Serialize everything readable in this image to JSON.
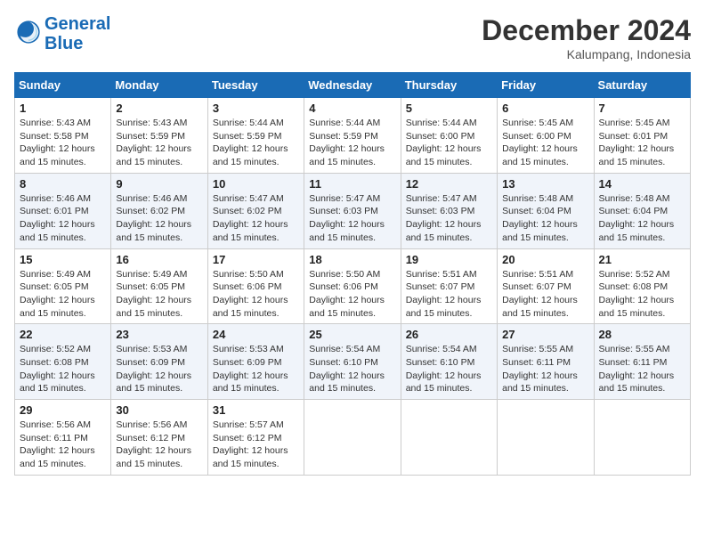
{
  "logo": {
    "line1": "General",
    "line2": "Blue"
  },
  "title": "December 2024",
  "location": "Kalumpang, Indonesia",
  "days_of_week": [
    "Sunday",
    "Monday",
    "Tuesday",
    "Wednesday",
    "Thursday",
    "Friday",
    "Saturday"
  ],
  "weeks": [
    [
      {
        "day": "1",
        "sunrise": "5:43 AM",
        "sunset": "5:58 PM",
        "daylight": "12 hours and 15 minutes."
      },
      {
        "day": "2",
        "sunrise": "5:43 AM",
        "sunset": "5:59 PM",
        "daylight": "12 hours and 15 minutes."
      },
      {
        "day": "3",
        "sunrise": "5:44 AM",
        "sunset": "5:59 PM",
        "daylight": "12 hours and 15 minutes."
      },
      {
        "day": "4",
        "sunrise": "5:44 AM",
        "sunset": "5:59 PM",
        "daylight": "12 hours and 15 minutes."
      },
      {
        "day": "5",
        "sunrise": "5:44 AM",
        "sunset": "6:00 PM",
        "daylight": "12 hours and 15 minutes."
      },
      {
        "day": "6",
        "sunrise": "5:45 AM",
        "sunset": "6:00 PM",
        "daylight": "12 hours and 15 minutes."
      },
      {
        "day": "7",
        "sunrise": "5:45 AM",
        "sunset": "6:01 PM",
        "daylight": "12 hours and 15 minutes."
      }
    ],
    [
      {
        "day": "8",
        "sunrise": "5:46 AM",
        "sunset": "6:01 PM",
        "daylight": "12 hours and 15 minutes."
      },
      {
        "day": "9",
        "sunrise": "5:46 AM",
        "sunset": "6:02 PM",
        "daylight": "12 hours and 15 minutes."
      },
      {
        "day": "10",
        "sunrise": "5:47 AM",
        "sunset": "6:02 PM",
        "daylight": "12 hours and 15 minutes."
      },
      {
        "day": "11",
        "sunrise": "5:47 AM",
        "sunset": "6:03 PM",
        "daylight": "12 hours and 15 minutes."
      },
      {
        "day": "12",
        "sunrise": "5:47 AM",
        "sunset": "6:03 PM",
        "daylight": "12 hours and 15 minutes."
      },
      {
        "day": "13",
        "sunrise": "5:48 AM",
        "sunset": "6:04 PM",
        "daylight": "12 hours and 15 minutes."
      },
      {
        "day": "14",
        "sunrise": "5:48 AM",
        "sunset": "6:04 PM",
        "daylight": "12 hours and 15 minutes."
      }
    ],
    [
      {
        "day": "15",
        "sunrise": "5:49 AM",
        "sunset": "6:05 PM",
        "daylight": "12 hours and 15 minutes."
      },
      {
        "day": "16",
        "sunrise": "5:49 AM",
        "sunset": "6:05 PM",
        "daylight": "12 hours and 15 minutes."
      },
      {
        "day": "17",
        "sunrise": "5:50 AM",
        "sunset": "6:06 PM",
        "daylight": "12 hours and 15 minutes."
      },
      {
        "day": "18",
        "sunrise": "5:50 AM",
        "sunset": "6:06 PM",
        "daylight": "12 hours and 15 minutes."
      },
      {
        "day": "19",
        "sunrise": "5:51 AM",
        "sunset": "6:07 PM",
        "daylight": "12 hours and 15 minutes."
      },
      {
        "day": "20",
        "sunrise": "5:51 AM",
        "sunset": "6:07 PM",
        "daylight": "12 hours and 15 minutes."
      },
      {
        "day": "21",
        "sunrise": "5:52 AM",
        "sunset": "6:08 PM",
        "daylight": "12 hours and 15 minutes."
      }
    ],
    [
      {
        "day": "22",
        "sunrise": "5:52 AM",
        "sunset": "6:08 PM",
        "daylight": "12 hours and 15 minutes."
      },
      {
        "day": "23",
        "sunrise": "5:53 AM",
        "sunset": "6:09 PM",
        "daylight": "12 hours and 15 minutes."
      },
      {
        "day": "24",
        "sunrise": "5:53 AM",
        "sunset": "6:09 PM",
        "daylight": "12 hours and 15 minutes."
      },
      {
        "day": "25",
        "sunrise": "5:54 AM",
        "sunset": "6:10 PM",
        "daylight": "12 hours and 15 minutes."
      },
      {
        "day": "26",
        "sunrise": "5:54 AM",
        "sunset": "6:10 PM",
        "daylight": "12 hours and 15 minutes."
      },
      {
        "day": "27",
        "sunrise": "5:55 AM",
        "sunset": "6:11 PM",
        "daylight": "12 hours and 15 minutes."
      },
      {
        "day": "28",
        "sunrise": "5:55 AM",
        "sunset": "6:11 PM",
        "daylight": "12 hours and 15 minutes."
      }
    ],
    [
      {
        "day": "29",
        "sunrise": "5:56 AM",
        "sunset": "6:11 PM",
        "daylight": "12 hours and 15 minutes."
      },
      {
        "day": "30",
        "sunrise": "5:56 AM",
        "sunset": "6:12 PM",
        "daylight": "12 hours and 15 minutes."
      },
      {
        "day": "31",
        "sunrise": "5:57 AM",
        "sunset": "6:12 PM",
        "daylight": "12 hours and 15 minutes."
      },
      null,
      null,
      null,
      null
    ]
  ],
  "labels": {
    "sunrise": "Sunrise:",
    "sunset": "Sunset:",
    "daylight": "Daylight:"
  }
}
